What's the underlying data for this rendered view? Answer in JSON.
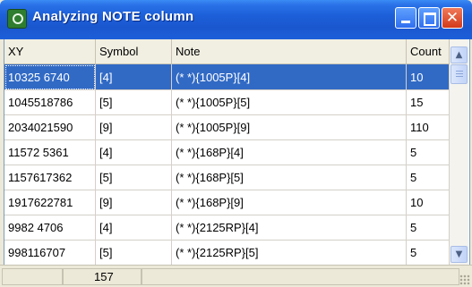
{
  "window": {
    "title": "Analyzing NOTE column"
  },
  "icons": {
    "app": "app-icon",
    "minimize": "minimize-icon",
    "maximize": "maximize-icon",
    "close": "close-icon"
  },
  "table": {
    "columns": [
      "XY",
      "Symbol",
      "Note",
      "Count"
    ],
    "rows": [
      [
        "10325 6740",
        "[4]",
        "(* *){1005P}[4]",
        "10"
      ],
      [
        "1045518786",
        "[5]",
        "(* *){1005P}[5]",
        "15"
      ],
      [
        "2034021590",
        "[9]",
        "(* *){1005P}[9]",
        "110"
      ],
      [
        "11572 5361",
        "[4]",
        "(* *){168P}[4]",
        "5"
      ],
      [
        "1157617362",
        "[5]",
        "(* *){168P}[5]",
        "5"
      ],
      [
        "1917622781",
        "[9]",
        "(* *){168P}[9]",
        "10"
      ],
      [
        "9982 4706",
        "[4]",
        "(* *){2125RP}[4]",
        "5"
      ],
      [
        "998116707",
        "[5]",
        "(* *){2125RP}[5]",
        "5"
      ]
    ],
    "selected_row": 0
  },
  "status": {
    "count": "157"
  }
}
